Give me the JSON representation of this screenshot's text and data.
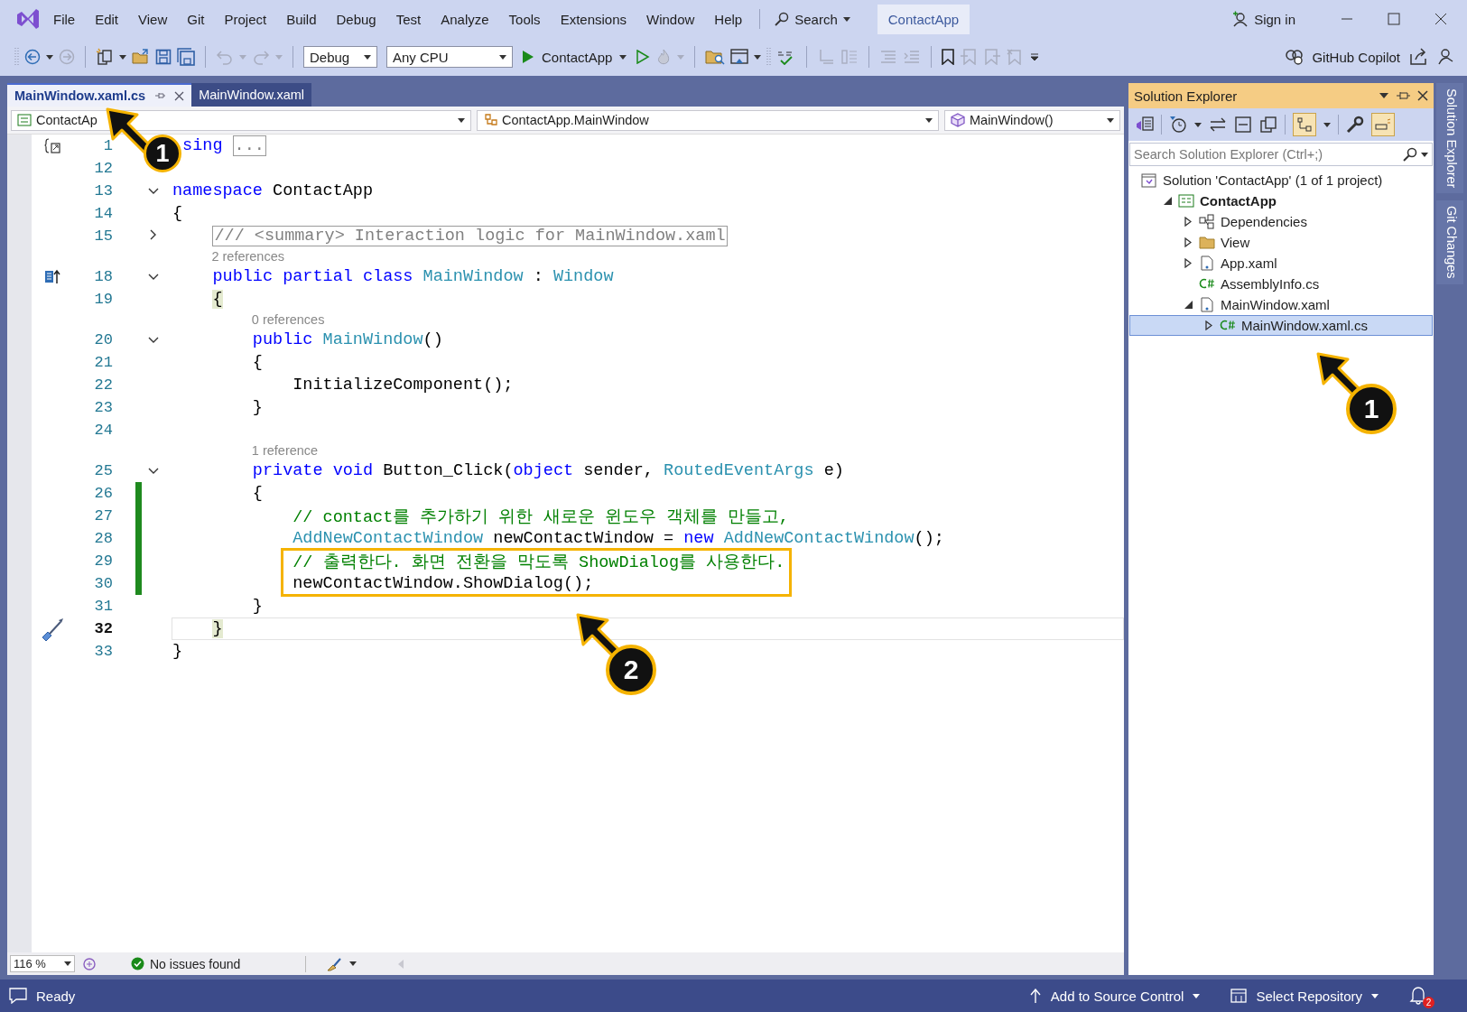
{
  "menu_bar": {
    "items": [
      "File",
      "Edit",
      "View",
      "Git",
      "Project",
      "Build",
      "Debug",
      "Test",
      "Analyze",
      "Tools",
      "Extensions",
      "Window",
      "Help"
    ],
    "search": "Search",
    "solution_name": "ContactApp",
    "sign_in": "Sign in"
  },
  "toolbar": {
    "configuration": "Debug",
    "platform": "Any CPU",
    "start_target": "ContactApp",
    "copilot": "GitHub Copilot"
  },
  "document_tabs": [
    {
      "label": "MainWindow.xaml.cs",
      "selected": true
    },
    {
      "label": "MainWindow.xaml",
      "selected": false
    }
  ],
  "navigation_bar": {
    "project": "ContactAp",
    "type": "ContactApp.MainWindow",
    "member": "MainWindow()"
  },
  "code_lines": [
    {
      "kind": "scope",
      "number": "1",
      "changed": false,
      "highlighted": false,
      "current": false,
      "tokens": [
        {
          "text": "sing ",
          "kind": "keyword"
        },
        {
          "text": "...",
          "kind": "collapsed"
        }
      ]
    },
    {
      "kind": "code",
      "number": "12",
      "changed": false,
      "highlighted": false,
      "current": false
    },
    {
      "kind": "code",
      "number": "13",
      "expanded": true,
      "changed": false,
      "highlighted": false,
      "current": false,
      "tokens": [
        {
          "text": "namespace",
          "kind": "keyword"
        },
        {
          "text": " ContactApp",
          "kind": "plain"
        }
      ]
    },
    {
      "kind": "code",
      "number": "14",
      "changed": false,
      "highlighted": false,
      "current": false,
      "tokens": [
        {
          "text": "{",
          "kind": "plain"
        }
      ]
    },
    {
      "kind": "code",
      "number": "15",
      "expanded": false,
      "changed": false,
      "highlighted": false,
      "current": false,
      "tokens": [
        {
          "text": "    /// <summary> Interaction logic for MainWindow.xaml",
          "kind": "collapsed"
        }
      ]
    },
    {
      "kind": "lens",
      "text": "2 references"
    },
    {
      "kind": "inheritance",
      "number": "18",
      "expanded": true,
      "changed": false,
      "highlighted": false,
      "current": false,
      "tokens": [
        {
          "text": "    public partial class ",
          "kind": "keyword"
        },
        {
          "text": "MainWindow",
          "kind": "type"
        },
        {
          "text": " : ",
          "kind": "plain"
        },
        {
          "text": "Window",
          "kind": "type"
        }
      ]
    },
    {
      "kind": "code",
      "number": "19",
      "changed": false,
      "highlighted": false,
      "current": false,
      "tokens": [
        {
          "text": "    {",
          "kind": "brace-match"
        }
      ]
    },
    {
      "kind": "lens",
      "text": "0 references"
    },
    {
      "kind": "code",
      "number": "20",
      "expanded": true,
      "changed": false,
      "highlighted": false,
      "current": false,
      "tokens": [
        {
          "text": "        public ",
          "kind": "keyword"
        },
        {
          "text": "MainWindow",
          "kind": "type"
        },
        {
          "text": "()",
          "kind": "plain"
        }
      ]
    },
    {
      "kind": "code",
      "number": "21",
      "changed": false,
      "highlighted": false,
      "current": false,
      "tokens": [
        {
          "text": "        {",
          "kind": "plain"
        }
      ]
    },
    {
      "kind": "code",
      "number": "22",
      "changed": false,
      "highlighted": false,
      "current": false,
      "tokens": [
        {
          "text": "            InitializeComponent();",
          "kind": "plain"
        }
      ]
    },
    {
      "kind": "code",
      "number": "23",
      "changed": false,
      "highlighted": false,
      "current": false,
      "tokens": [
        {
          "text": "        }",
          "kind": "plain"
        }
      ]
    },
    {
      "kind": "code",
      "number": "24",
      "changed": false,
      "highlighted": false,
      "current": false
    },
    {
      "kind": "lens",
      "text": "1 reference"
    },
    {
      "kind": "code",
      "number": "25",
      "expanded": true,
      "changed": false,
      "highlighted": false,
      "current": false,
      "tokens": [
        {
          "text": "        private void",
          "kind": "keyword"
        },
        {
          "text": " Button_Click(",
          "kind": "plain"
        },
        {
          "text": "object",
          "kind": "keyword"
        },
        {
          "text": " sender, ",
          "kind": "plain"
        },
        {
          "text": "RoutedEventArgs",
          "kind": "type"
        },
        {
          "text": " e)",
          "kind": "plain"
        }
      ]
    },
    {
      "kind": "code",
      "number": "26",
      "changed": true,
      "highlighted": false,
      "current": false,
      "tokens": [
        {
          "text": "        {",
          "kind": "plain"
        }
      ]
    },
    {
      "kind": "code",
      "number": "27",
      "changed": true,
      "highlighted": false,
      "current": false,
      "tokens": [
        {
          "text": "            // contact를 추가하기 위한 새로운 윈도우 객체를 만들고,",
          "kind": "comment"
        }
      ]
    },
    {
      "kind": "code",
      "number": "28",
      "changed": true,
      "highlighted": false,
      "current": false,
      "tokens": [
        {
          "text": "            AddNewContactWindow",
          "kind": "type"
        },
        {
          "text": " newContactWindow = ",
          "kind": "plain"
        },
        {
          "text": "new ",
          "kind": "keyword"
        },
        {
          "text": "AddNewContactWindow",
          "kind": "type"
        },
        {
          "text": "();",
          "kind": "plain"
        }
      ]
    },
    {
      "kind": "code",
      "number": "29",
      "changed": true,
      "highlighted": true,
      "current": false,
      "tokens": [
        {
          "text": "            // 출력한다. 화면 전환을 막도록 ShowDialog를 사용한다.",
          "kind": "comment"
        }
      ]
    },
    {
      "kind": "code",
      "number": "30",
      "changed": true,
      "highlighted": true,
      "current": false,
      "tokens": [
        {
          "text": "            newContactWindow.ShowDialog();",
          "kind": "plain"
        }
      ]
    },
    {
      "kind": "code",
      "number": "31",
      "changed": false,
      "highlighted": false,
      "current": false,
      "tokens": [
        {
          "text": "        }",
          "kind": "plain"
        }
      ]
    },
    {
      "kind": "quick-action",
      "number": "32",
      "changed": false,
      "highlighted": false,
      "current": true,
      "tokens": [
        {
          "text": "    }",
          "kind": "brace-match"
        }
      ]
    },
    {
      "kind": "code",
      "number": "33",
      "changed": false,
      "highlighted": false,
      "current": false,
      "tokens": [
        {
          "text": "}",
          "kind": "plain"
        }
      ]
    }
  ],
  "editor_status": {
    "zoom": "116 %",
    "issues": "No issues found"
  },
  "solution_explorer": {
    "title": "Solution Explorer",
    "search": {
      "placeholder": "Search Solution Explorer (Ctrl+;)"
    },
    "tree": [
      {
        "label": "Solution 'ContactApp' (1 of 1 project)",
        "kind": "solution",
        "selected": false,
        "children": [
          {
            "label": "ContactApp",
            "kind": "project",
            "expanded": true,
            "selected": false,
            "children": [
              {
                "label": "Dependencies",
                "kind": "dependencies",
                "expanded": false,
                "selected": false
              },
              {
                "label": "View",
                "kind": "folder",
                "expanded": false,
                "selected": false
              },
              {
                "label": "App.xaml",
                "kind": "xaml",
                "expanded": false,
                "selected": false
              },
              {
                "label": "AssemblyInfo.cs",
                "kind": "csharp",
                "selected": false
              },
              {
                "label": "MainWindow.xaml",
                "kind": "xaml",
                "expanded": true,
                "selected": false,
                "children": [
                  {
                    "label": "MainWindow.xaml.cs",
                    "kind": "csharp",
                    "expanded": false,
                    "selected": true
                  }
                ]
              }
            ]
          }
        ]
      }
    ]
  },
  "side_tabs": [
    "Solution Explorer",
    "Git Changes"
  ],
  "status_bar": {
    "state": "Ready",
    "source_control": "Add to Source Control",
    "repository": "Select Repository",
    "notifications": "2"
  },
  "callouts": [
    {
      "label": "1"
    },
    {
      "label": "1"
    },
    {
      "label": "2"
    }
  ]
}
